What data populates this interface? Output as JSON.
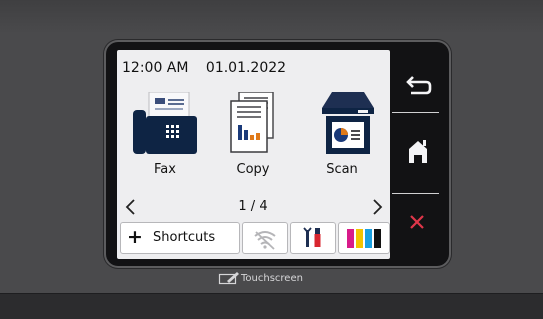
{
  "status": {
    "time": "12:00 AM",
    "date": "01.01.2022"
  },
  "apps": [
    {
      "label": "Fax",
      "icon": "fax-icon"
    },
    {
      "label": "Copy",
      "icon": "copy-icon"
    },
    {
      "label": "Scan",
      "icon": "scan-icon"
    }
  ],
  "pager": {
    "page": "1 / 4",
    "prev_icon": "chevron-left-icon",
    "next_icon": "chevron-right-icon"
  },
  "bottom_bar": {
    "shortcuts_label": "Shortcuts",
    "plus_symbol": "+",
    "wifi_icon": "wifi-off-icon",
    "settings_icon": "settings-tools-icon",
    "toner_icon": "toner-icon",
    "toner_colors": [
      "#d81b8a",
      "#f2c400",
      "#1aa0e0",
      "#111111"
    ]
  },
  "side_buttons": [
    {
      "name": "back",
      "icon": "back-arrow-icon"
    },
    {
      "name": "home",
      "icon": "home-icon"
    },
    {
      "name": "cancel",
      "icon": "close-icon",
      "color": "#e0364a"
    }
  ],
  "brand": {
    "label": "Touchscreen",
    "icon": "touchscreen-icon"
  }
}
